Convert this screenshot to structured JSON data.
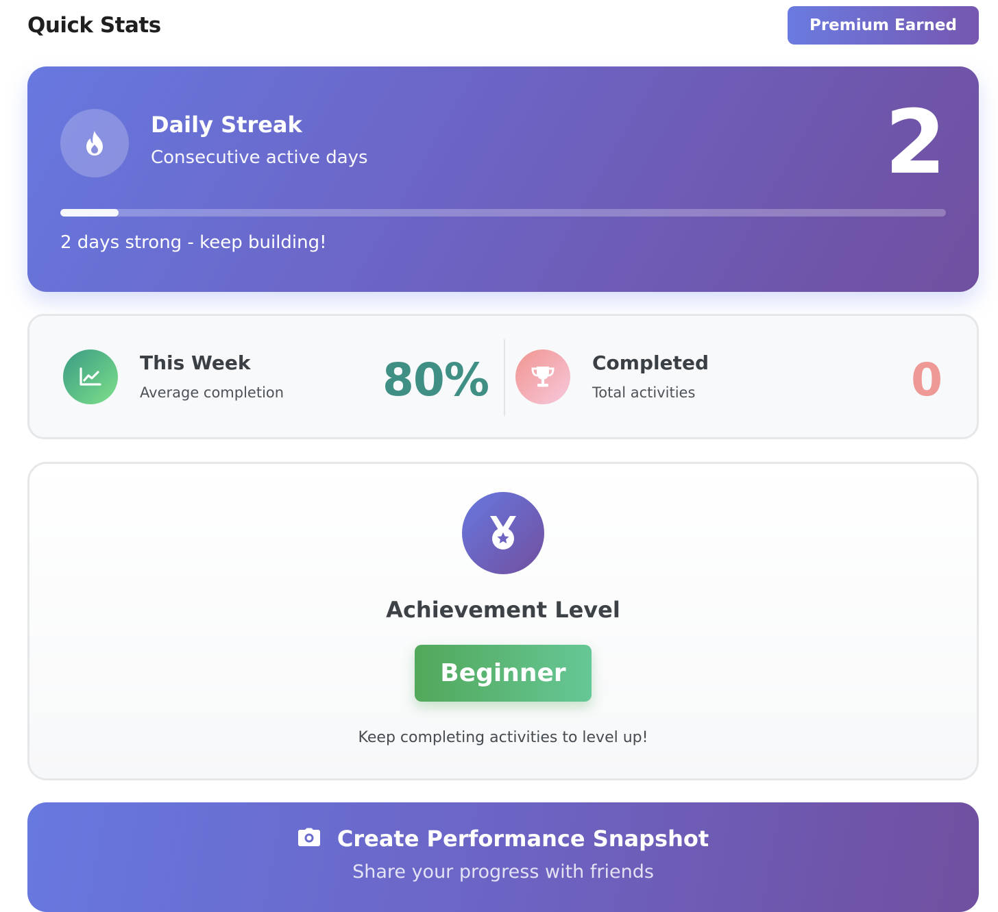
{
  "header": {
    "title": "Quick Stats",
    "premium_label": "Premium Earned"
  },
  "streak": {
    "title": "Daily Streak",
    "subtitle": "Consecutive active days",
    "value": "2",
    "progress_fraction": 0.066,
    "message": "2 days strong - keep building!",
    "icon": "fire-icon"
  },
  "week": {
    "title": "This Week",
    "subtitle": "Average completion",
    "value": "80%",
    "icon": "chart-line-icon",
    "color": "#3f8f84"
  },
  "completed": {
    "title": "Completed",
    "subtitle": "Total activities",
    "value": "0",
    "icon": "trophy-icon",
    "color": "#ef9996"
  },
  "achievement": {
    "title": "Achievement Level",
    "level": "Beginner",
    "message": "Keep completing activities to level up!",
    "icon": "medal-icon"
  },
  "snapshot": {
    "title": "Create Performance Snapshot",
    "subtitle": "Share your progress with friends",
    "icon": "camera-icon"
  },
  "colors": {
    "brand_start": "#6778df",
    "brand_end": "#704f9f",
    "success_start": "#52a85a",
    "success_end": "#66c796"
  }
}
